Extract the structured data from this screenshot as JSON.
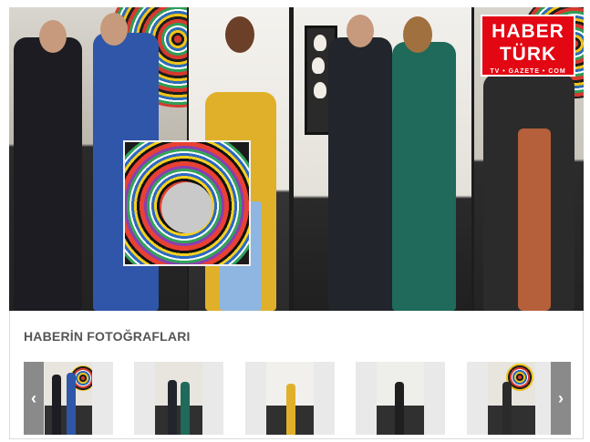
{
  "logo": {
    "main": "HABER TÜRK",
    "sub": "TV • GAZETE • COM"
  },
  "gallery": {
    "title": "HABERİN FOTOĞRAFLARI",
    "prev_icon": "‹",
    "next_icon": "›",
    "thumbnails": [
      {
        "name": "photo-1"
      },
      {
        "name": "photo-2"
      },
      {
        "name": "photo-3"
      },
      {
        "name": "photo-4"
      },
      {
        "name": "photo-5"
      }
    ]
  },
  "colors": {
    "brand_red": "#e30613",
    "arrow_gray": "#8a8a8a",
    "title_gray": "#555555"
  }
}
